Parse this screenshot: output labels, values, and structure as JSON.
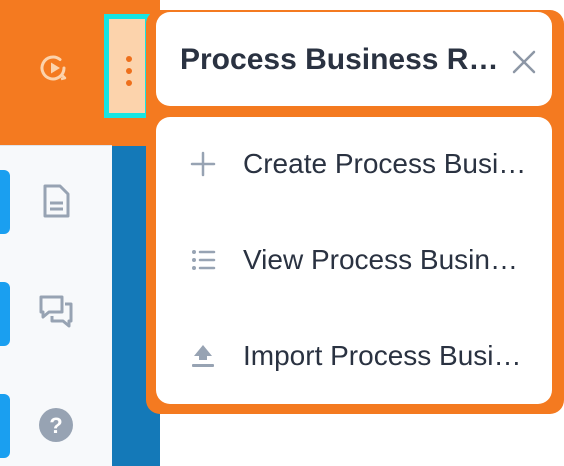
{
  "popup": {
    "title": "Process Business Rules",
    "close_icon": "close-icon"
  },
  "menu": {
    "items": [
      {
        "label": "Create Process Business Rule",
        "icon": "plus-icon"
      },
      {
        "label": "View Process Business Rules",
        "icon": "list-icon"
      },
      {
        "label": "Import Process Business Rules",
        "icon": "upload-icon"
      }
    ]
  },
  "sidebar": {
    "header_icon": "play-sync-icon",
    "items": [
      {
        "icon": "document-icon"
      },
      {
        "icon": "chat-icon"
      },
      {
        "icon": "help-icon"
      }
    ],
    "more_button_icon": "kebab-menu-icon"
  },
  "colors": {
    "accent_orange": "#f47a20",
    "sidebar_blue": "#1479b8",
    "highlight_cyan": "#16e5e2",
    "active_accent": "#1a9ff0",
    "text_dark": "#2a3241",
    "icon_gray": "#97a3b3"
  }
}
